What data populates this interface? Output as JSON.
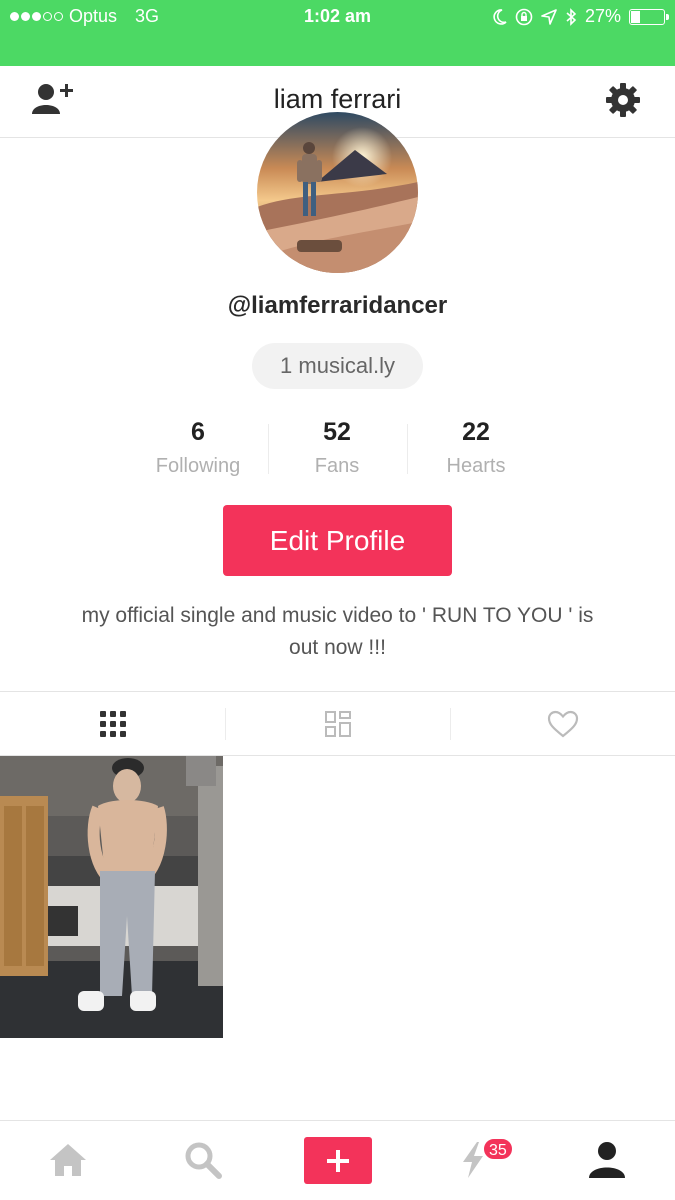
{
  "status_bar": {
    "carrier": "Optus",
    "network": "3G",
    "time": "1:02 am",
    "battery": "27%",
    "battery_level": 0.27
  },
  "header": {
    "title": "liam ferrari"
  },
  "profile": {
    "handle": "@liamferraridancer",
    "musicals": "1 musical.ly",
    "stats": [
      {
        "value": "6",
        "label": "Following"
      },
      {
        "value": "52",
        "label": "Fans"
      },
      {
        "value": "22",
        "label": "Hearts"
      }
    ],
    "edit_label": "Edit Profile",
    "bio": "my official single and music video to ' RUN TO YOU ' is out now !!!"
  },
  "tabs": [
    {
      "icon": "grid-icon",
      "active": true
    },
    {
      "icon": "dashboard-icon",
      "active": false
    },
    {
      "icon": "heart-icon",
      "active": false
    }
  ],
  "bottom_nav": {
    "items": [
      "home-icon",
      "search-icon",
      "plus-icon",
      "notifications-icon",
      "profile-icon"
    ],
    "notification_count": "35"
  },
  "colors": {
    "status_bar": "#4cd964",
    "accent": "#f3335a",
    "muted": "#b0b0b0"
  }
}
